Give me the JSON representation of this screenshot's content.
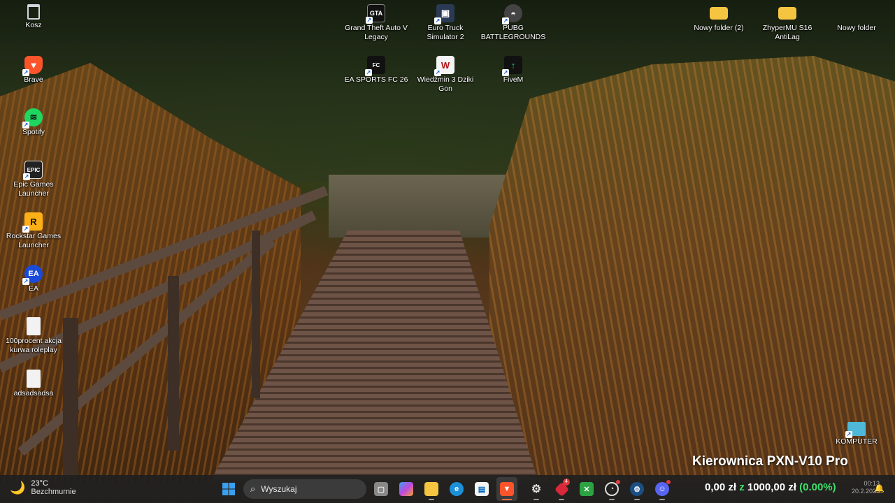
{
  "desktop": {
    "icons_left": [
      {
        "label": "Kosz",
        "icon": "recycle-bin-icon"
      },
      {
        "label": "Brave",
        "icon": "brave-icon"
      },
      {
        "label": "Spotify",
        "icon": "spotify-icon"
      },
      {
        "label": "Epic Games Launcher",
        "icon": "epic-games-icon"
      },
      {
        "label": "Rockstar Games Launcher",
        "icon": "rockstar-icon"
      },
      {
        "label": "EA",
        "icon": "ea-icon"
      },
      {
        "label": "100procent akcja kurwa roleplay",
        "icon": "file-icon"
      },
      {
        "label": "adsadsadsa",
        "icon": "file-icon"
      }
    ],
    "icons_top": [
      {
        "label": "Grand Theft Auto V Legacy",
        "icon": "gta-icon"
      },
      {
        "label": "Euro Truck Simulator 2",
        "icon": "ets2-icon"
      },
      {
        "label": "PUBG BATTLEGROUNDS",
        "icon": "pubg-icon"
      },
      {
        "label": "EA SPORTS FC 26",
        "icon": "fc26-icon"
      },
      {
        "label": "Wiedźmin 3 Dziki Gon",
        "icon": "witcher-icon"
      },
      {
        "label": "FiveM",
        "icon": "fivem-icon"
      }
    ],
    "icons_right": [
      {
        "label": "Nowy folder (2)",
        "icon": "folder-icon"
      },
      {
        "label": "ZhyperMU S16 AntiLag",
        "icon": "folder-icon"
      },
      {
        "label": "Nowy folder",
        "icon": "folder-icon"
      },
      {
        "label": "KOMPUTER",
        "icon": "computer-icon"
      }
    ],
    "overlay_title": "Kierownica PXN-V10 Pro"
  },
  "taskbar": {
    "weather": {
      "temp": "23°C",
      "condition": "Bezchmurnie",
      "icon": "moon-icon"
    },
    "search_placeholder": "Wyszukaj",
    "apps": [
      {
        "name": "task-view",
        "icon": "task-view-icon",
        "glyph": "▢"
      },
      {
        "name": "copilot",
        "icon": "copilot-icon",
        "glyph": "✦"
      },
      {
        "name": "file-explorer",
        "icon": "folder-icon",
        "glyph": "▬"
      },
      {
        "name": "edge",
        "icon": "edge-icon",
        "glyph": "e"
      },
      {
        "name": "store",
        "icon": "store-icon",
        "glyph": "▤"
      },
      {
        "name": "brave",
        "icon": "brave-icon",
        "glyph": "▼"
      },
      {
        "name": "settings",
        "icon": "gear-icon",
        "glyph": "⚙"
      },
      {
        "name": "app-badge",
        "icon": "diamond-icon",
        "glyph": "◆",
        "badge": "4"
      },
      {
        "name": "xbox",
        "icon": "xbox-icon",
        "glyph": "✕"
      },
      {
        "name": "gauge",
        "icon": "gauge-icon",
        "glyph": "◔"
      },
      {
        "name": "steam",
        "icon": "steam-icon",
        "glyph": "⚙"
      },
      {
        "name": "discord",
        "icon": "discord-icon",
        "glyph": "☺"
      }
    ],
    "money": {
      "amount": "0,00 zł",
      "sep": "z",
      "goal": "1000,00 zł",
      "percent": "(0.00%)"
    },
    "clock": {
      "time": "00:13",
      "date": "20.2.2026"
    }
  },
  "colors": {
    "accent_green": "#3ee06a",
    "taskbar": "#202020"
  }
}
